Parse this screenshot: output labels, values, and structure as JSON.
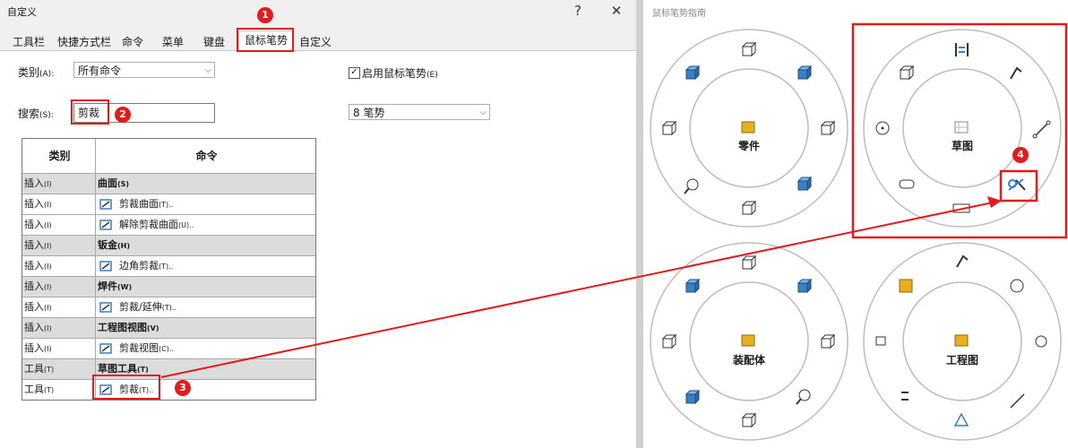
{
  "window": {
    "title": "自定义",
    "help": "?",
    "close": "✕"
  },
  "tabs": [
    "工具栏",
    "快捷方式栏",
    "命令",
    "菜单",
    "键盘",
    "鼠标笔势",
    "自定义"
  ],
  "active_tab": "鼠标笔势",
  "category": {
    "label": "类别",
    "shortcut": "(A):",
    "value": "所有命令"
  },
  "enable_gestures": {
    "label": "启用鼠标笔势",
    "shortcut": "(E)",
    "checked": true
  },
  "search": {
    "label": "搜索",
    "shortcut": "(S):",
    "value": "剪裁"
  },
  "gesture_count": {
    "value": "8 笔势"
  },
  "table": {
    "headers": [
      "类别",
      "命令"
    ],
    "rows": [
      {
        "type": "cat",
        "c1": "插入",
        "c1s": "(I)",
        "c2": "曲面",
        "c2s": "(S)"
      },
      {
        "type": "cmd",
        "c1": "插入",
        "c1s": "(I)",
        "c2": "剪裁曲面",
        "c2s": "(T)..",
        "icon": "trim-surface-icon"
      },
      {
        "type": "cmd",
        "c1": "插入",
        "c1s": "(I)",
        "c2": "解除剪裁曲面",
        "c2s": "(U)..",
        "icon": "untrim-surface-icon"
      },
      {
        "type": "cat",
        "c1": "插入",
        "c1s": "(I)",
        "c2": "钣金",
        "c2s": "(H)"
      },
      {
        "type": "cmd",
        "c1": "插入",
        "c1s": "(I)",
        "c2": "边角剪裁",
        "c2s": "(T)..",
        "icon": "corner-trim-icon"
      },
      {
        "type": "cat",
        "c1": "插入",
        "c1s": "(I)",
        "c2": "焊件",
        "c2s": "(W)"
      },
      {
        "type": "cmd",
        "c1": "插入",
        "c1s": "(I)",
        "c2": "剪裁/延伸",
        "c2s": "(T)..",
        "icon": "trim-extend-icon"
      },
      {
        "type": "cat",
        "c1": "插入",
        "c1s": "(I)",
        "c2": "工程图视图",
        "c2s": "(V)"
      },
      {
        "type": "cmd",
        "c1": "插入",
        "c1s": "(I)",
        "c2": "剪裁视图",
        "c2s": "(C)..",
        "icon": "crop-view-icon"
      },
      {
        "type": "cat",
        "c1": "工具",
        "c1s": "(T)",
        "c2": "草图工具",
        "c2s": "(T)"
      },
      {
        "type": "cmd",
        "c1": "工具",
        "c1s": "(T)",
        "c2": "剪裁",
        "c2s": "(T)..",
        "icon": "sketch-trim-icon"
      }
    ]
  },
  "badges": [
    "1",
    "2",
    "3",
    "4"
  ],
  "guide": {
    "title": "鼠标笔势指南",
    "wheels": [
      "零件",
      "草图",
      "装配体",
      "工程图"
    ]
  },
  "colors": {
    "highlight": "#e21b1b",
    "icon_blue": "#3a7fc1",
    "icon_yellow": "#e8b020"
  }
}
